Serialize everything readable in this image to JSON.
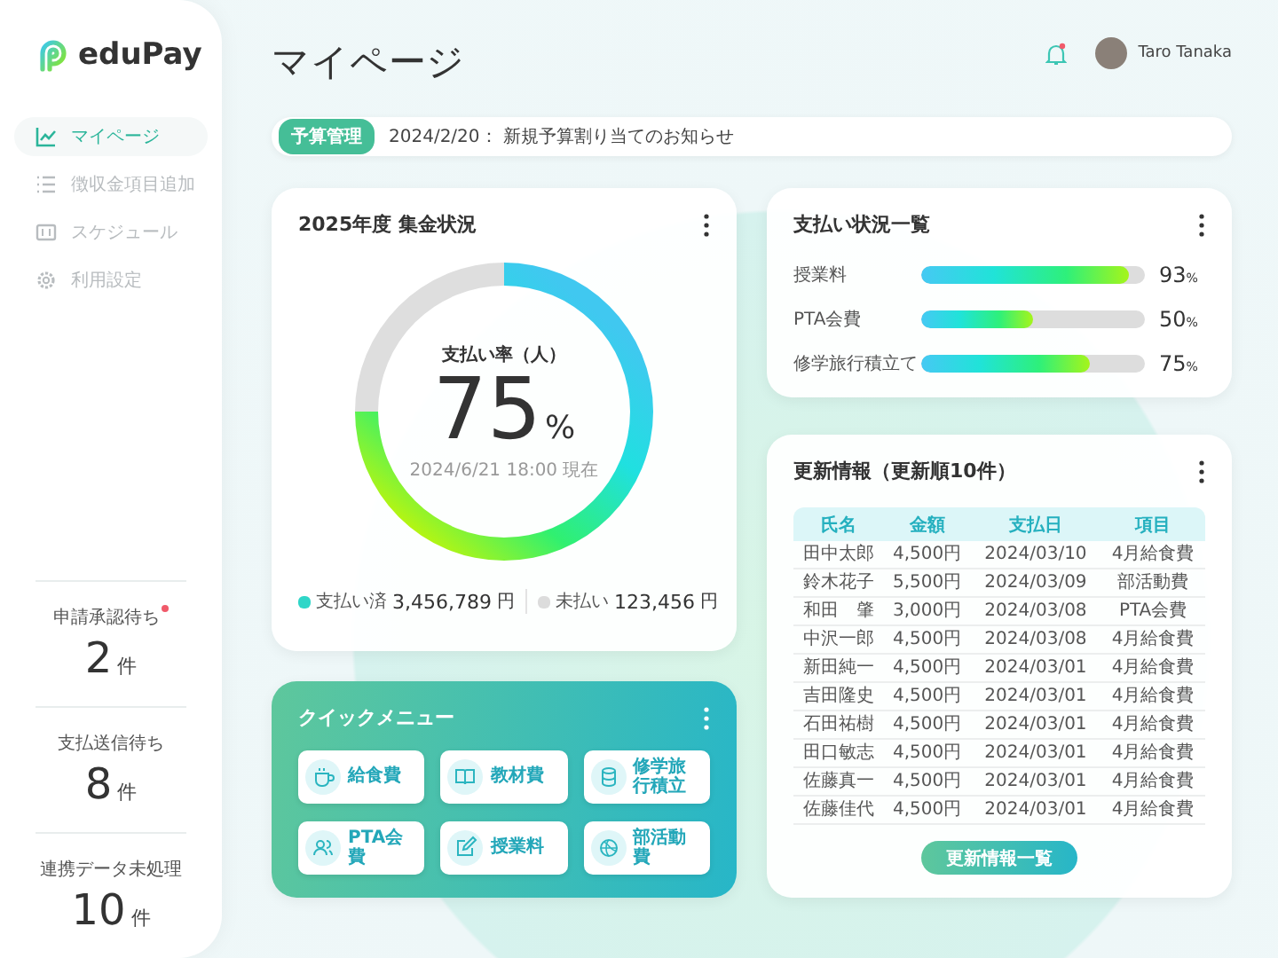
{
  "sidebar": {
    "logo": "eduPay",
    "items": [
      {
        "label": "マイページ",
        "kind": "chart",
        "selected": true
      },
      {
        "label": "徴収金項目追加",
        "kind": "list",
        "selected": false
      },
      {
        "label": "スケジュール",
        "kind": "calendar",
        "selected": false
      },
      {
        "label": "利用設定",
        "kind": "gear",
        "selected": false
      }
    ],
    "stats": [
      {
        "label": "申請承認待ち",
        "alert": true,
        "value": "2",
        "unit": "件"
      },
      {
        "label": "支払送信待ち",
        "alert": false,
        "value": "8",
        "unit": "件"
      },
      {
        "label": "連携データ未処理",
        "alert": false,
        "value": "10",
        "unit": "件"
      }
    ]
  },
  "header": {
    "title": "マイページ",
    "notification": true,
    "user": "Taro Tanaka"
  },
  "notice": {
    "tag": "予算管理",
    "text": "2024/2/20： 新規予算割り当てのお知らせ"
  },
  "collection": {
    "title": "2025年度 集金状況",
    "caption": "支払い率（人）",
    "value": "75",
    "unit": "%",
    "chart_data": {
      "type": "donut",
      "values": [
        75,
        25
      ]
    },
    "timestamp": "2024/6/21 18:00 現在",
    "legend": [
      {
        "label": "支払い済",
        "amount": "3,456,789",
        "unit": "円",
        "color": "#2fd6c8"
      },
      {
        "label": "未払い",
        "amount": "123,456",
        "unit": "円",
        "color": "#dcdcdc"
      }
    ]
  },
  "payment_status": {
    "title": "支払い状況一覧",
    "items": [
      {
        "label": "授業料",
        "level": 0.93,
        "value": "93",
        "unit": "%"
      },
      {
        "label": "PTA会費",
        "level": 0.5,
        "value": "50",
        "unit": "%"
      },
      {
        "label": "修学旅行積立て",
        "level": 0.75,
        "value": "75",
        "unit": "%"
      }
    ]
  },
  "quick_menu": {
    "title": "クイックメニュー",
    "items": [
      {
        "label": "給食費",
        "kind": "cup"
      },
      {
        "label": "教材費",
        "kind": "book"
      },
      {
        "label": "修学旅行積立",
        "kind": "database"
      },
      {
        "label": "PTA会費",
        "kind": "people"
      },
      {
        "label": "授業料",
        "kind": "edit"
      },
      {
        "label": "部活動費",
        "kind": "ball"
      }
    ]
  },
  "updates": {
    "title": "更新情報（更新順10件）",
    "columns": [
      "氏名",
      "金額",
      "支払日",
      "項目"
    ],
    "rows": [
      [
        "田中太郎",
        "4,500円",
        "2024/03/10",
        "4月給食費"
      ],
      [
        "鈴木花子",
        "5,500円",
        "2024/03/09",
        "部活動費"
      ],
      [
        "和田　肇",
        "3,000円",
        "2024/03/08",
        "PTA会費"
      ],
      [
        "中沢一郎",
        "4,500円",
        "2024/03/08",
        "4月給食費"
      ],
      [
        "新田純一",
        "4,500円",
        "2024/03/01",
        "4月給食費"
      ],
      [
        "吉田隆史",
        "4,500円",
        "2024/03/01",
        "4月給食費"
      ],
      [
        "石田祐樹",
        "4,500円",
        "2024/03/01",
        "4月給食費"
      ],
      [
        "田口敏志",
        "4,500円",
        "2024/03/01",
        "4月給食費"
      ],
      [
        "佐藤真一",
        "4,500円",
        "2024/03/01",
        "4月給食費"
      ],
      [
        "佐藤佳代",
        "4,500円",
        "2024/03/01",
        "4月給食費"
      ]
    ],
    "button": "更新情報一覧"
  }
}
